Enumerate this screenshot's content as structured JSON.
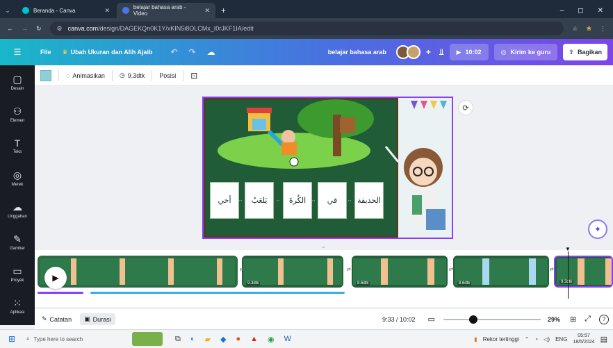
{
  "browser": {
    "tabs": [
      {
        "title": "Beranda - Canva",
        "active": false
      },
      {
        "title": "belajar bahasa arab - Video",
        "active": true
      }
    ],
    "new_tab": "+",
    "url_prefix": "canva.com",
    "url_rest": "/design/DAGEKQn0K1Y/xKIN5i8OLCMx_I0rJKF1IA/edit",
    "minimize": "–",
    "maximize": "◻",
    "close": "✕"
  },
  "header": {
    "menu_icon": "☰",
    "file": "File",
    "resize": "Ubah Ukuran dan Alih Ajaib",
    "undo": "↶",
    "redo": "↷",
    "title": "belajar bahasa arab",
    "add_collab": "+",
    "play_time": "10:02",
    "send_teacher": "Kirim ke guru",
    "share": "Bagikan"
  },
  "sidebar": {
    "items": [
      {
        "label": "Desain",
        "icon": "▢"
      },
      {
        "label": "Elemen",
        "icon": "⚇"
      },
      {
        "label": "Teks",
        "icon": "T"
      },
      {
        "label": "Merek",
        "icon": "◎"
      },
      {
        "label": "Unggahan",
        "icon": "☁"
      },
      {
        "label": "Gambar",
        "icon": "✎"
      },
      {
        "label": "Proyek",
        "icon": "▭"
      },
      {
        "label": "Aplikasi",
        "icon": "⁙"
      }
    ]
  },
  "toolbar": {
    "animate": "Animasikan",
    "duration": "9.3dtk",
    "position": "Posisi"
  },
  "slide": {
    "words": [
      "الحديقة",
      "في",
      "الكُرةَ",
      "يَلعَبُ",
      "أخي"
    ],
    "colors": {
      "board": "#1f5c37",
      "frame": "#8b3dff"
    }
  },
  "timeline": {
    "clips": [
      {
        "label": ""
      },
      {
        "label": "9.3dtk"
      },
      {
        "label": "8.6dtk"
      },
      {
        "label": "8.6dtk"
      },
      {
        "label": "9.3dtk"
      }
    ]
  },
  "bottombar": {
    "notes": "Catatan",
    "duration": "Durasi",
    "time": "9:33 / 10:02",
    "zoom": "29%",
    "zoom_level": 0.29,
    "help": "?"
  },
  "taskbar": {
    "search_placeholder": "Type here to search",
    "news": "Rekor tertinggi",
    "lang": "ENG",
    "time": "05:57",
    "date": "18/5/2024"
  }
}
